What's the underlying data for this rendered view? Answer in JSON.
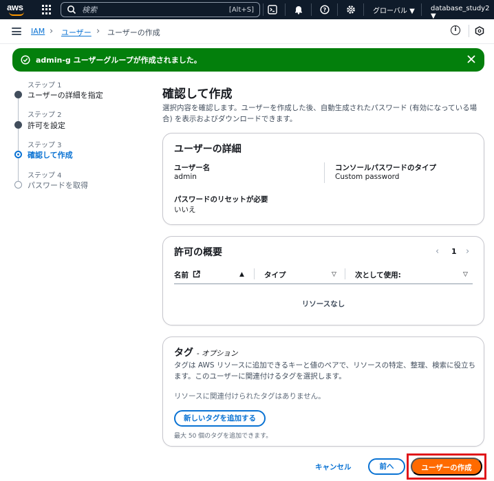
{
  "topnav": {
    "logo": "aws",
    "search_placeholder": "検索",
    "search_shortcut": "[Alt+S]",
    "region": "グローバル ▼",
    "account": "database_study2 ▼",
    "icons": [
      "grid-icon",
      "search-icon",
      "cloudshell-icon",
      "bell-icon",
      "help-icon",
      "gear-icon"
    ]
  },
  "breadcrumb": {
    "items": [
      "IAM",
      "ユーザー",
      "ユーザーの作成"
    ]
  },
  "flash": {
    "message": "admin-g ユーザーグループが作成されました。",
    "color": "#037f0c"
  },
  "steps": [
    {
      "num": "ステップ 1",
      "label": "ユーザーの詳細を指定",
      "state": "done"
    },
    {
      "num": "ステップ 2",
      "label": "許可を設定",
      "state": "done"
    },
    {
      "num": "ステップ 3",
      "label": "確認して作成",
      "state": "active"
    },
    {
      "num": "ステップ 4",
      "label": "パスワードを取得",
      "state": "todo"
    }
  ],
  "main": {
    "title": "確認して作成",
    "description": "選択内容を確認します。ユーザーを作成した後、自動生成されたパスワード (有効になっている場合) を表示およびダウンロードできます。"
  },
  "user_details": {
    "title": "ユーザーの詳細",
    "username_label": "ユーザー名",
    "username_value": "admin",
    "console_pw_label": "コンソールパスワードのタイプ",
    "console_pw_value": "Custom password",
    "reset_label": "パスワードのリセットが必要",
    "reset_value": "いいえ"
  },
  "permissions": {
    "title": "許可の概要",
    "page": "1",
    "col_name": "名前",
    "col_type": "タイプ",
    "col_used_as": "次として使用:",
    "empty": "リソースなし"
  },
  "tags": {
    "title": "タグ",
    "optional": "- オプション",
    "description": "タグは AWS リソースに追加できるキーと値のペアで、リソースの特定、整理、検索に役立ちます。このユーザーに関連付けるタグを選択します。",
    "none": "リソースに関連付けられたタグはありません。",
    "add_button": "新しいタグを追加する",
    "hint": "最大 50 個のタグを追加できます。"
  },
  "footer": {
    "cancel": "キャンセル",
    "prev": "前へ",
    "create": "ユーザーの作成",
    "accent": "#ff6a00"
  }
}
